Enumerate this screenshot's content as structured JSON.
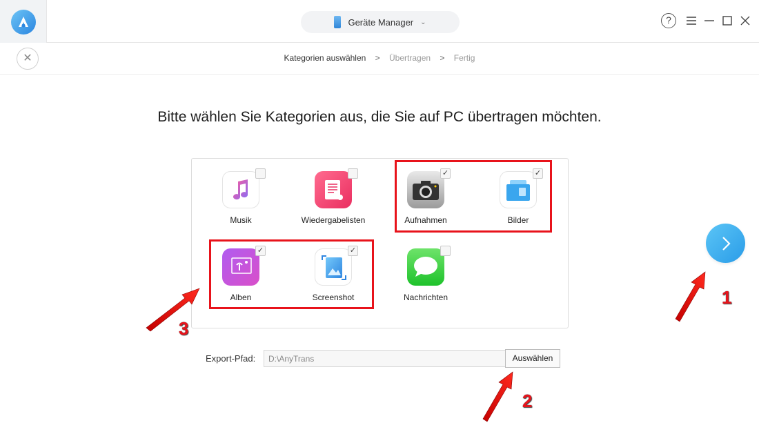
{
  "titlebar": {
    "device_label": "Geräte Manager",
    "help_label": "?"
  },
  "breadcrumb": {
    "steps": [
      "Kategorien auswählen",
      "Übertragen",
      "Fertig"
    ],
    "separator": ">"
  },
  "heading": "Bitte wählen Sie Kategorien aus, die Sie auf PC übertragen möchten.",
  "categories": [
    {
      "label": "Musik",
      "checked": false,
      "icon": "music-note-icon"
    },
    {
      "label": "Wiedergabelisten",
      "checked": false,
      "icon": "playlist-icon"
    },
    {
      "label": "Aufnahmen",
      "checked": true,
      "icon": "camera-icon"
    },
    {
      "label": "Bilder",
      "checked": true,
      "icon": "photos-icon"
    },
    {
      "label": "Alben",
      "checked": true,
      "icon": "albums-icon"
    },
    {
      "label": "Screenshot",
      "checked": true,
      "icon": "screenshot-icon"
    },
    {
      "label": "Nachrichten",
      "checked": false,
      "icon": "messages-icon"
    }
  ],
  "export": {
    "label": "Export-Pfad:",
    "path": "D:\\AnyTrans",
    "button": "Auswählen"
  },
  "annotations": {
    "one": "1",
    "two": "2",
    "three": "3"
  },
  "colors": {
    "accent_blue": "#2a9ce8",
    "highlight_red": "#e8131b"
  }
}
